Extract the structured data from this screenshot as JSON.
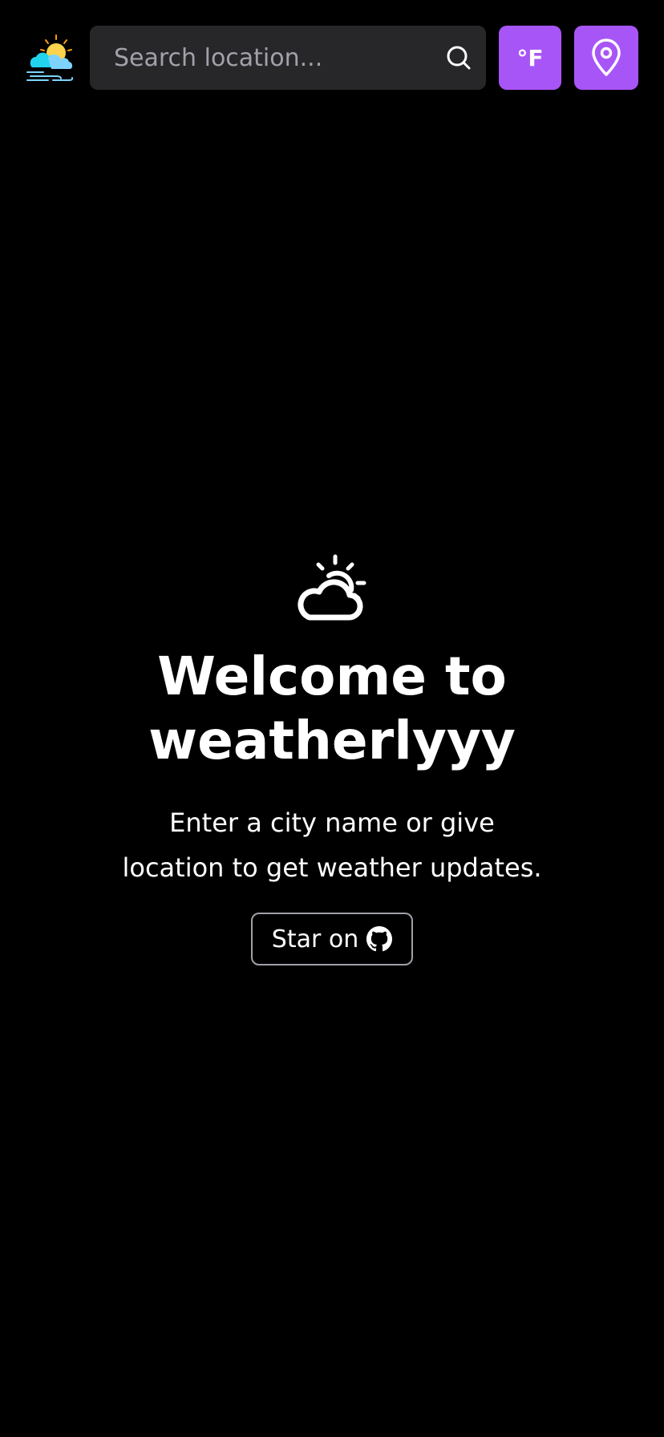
{
  "header": {
    "logo_icon": "weather-logo-icon",
    "search": {
      "placeholder": "Search location...",
      "value": "",
      "icon": "search-icon"
    },
    "unit_toggle_label": "°F",
    "location_icon": "map-pin-icon"
  },
  "hero": {
    "icon": "partly-cloudy-icon",
    "title_line1": "Welcome to",
    "title_line2": "weatherlyyy",
    "subtitle_line1": "Enter a city name or give",
    "subtitle_line2": "location to get weather updates.",
    "star_label": "Star on",
    "star_icon": "github-icon"
  },
  "colors": {
    "background": "#000000",
    "surface": "#27272a",
    "accent": "#a855f7",
    "text": "#ffffff",
    "placeholder": "#a1a1aa",
    "border": "#a1a1aa"
  }
}
